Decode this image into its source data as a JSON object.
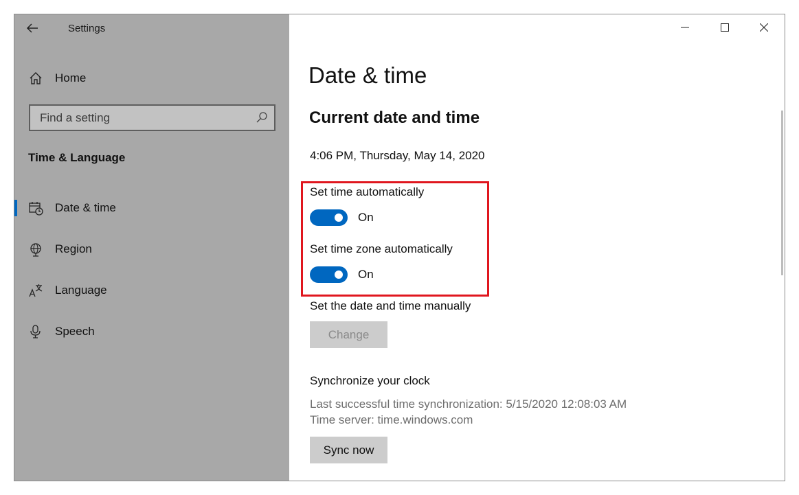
{
  "sidebar": {
    "app_title": "Settings",
    "home_label": "Home",
    "search": {
      "placeholder": "Find a setting"
    },
    "group_title": "Time & Language",
    "items": [
      {
        "label": "Date & time",
        "icon": "calendar-clock-icon",
        "selected": true
      },
      {
        "label": "Region",
        "icon": "globe-icon",
        "selected": false
      },
      {
        "label": "Language",
        "icon": "language-icon",
        "selected": false
      },
      {
        "label": "Speech",
        "icon": "microphone-icon",
        "selected": false
      }
    ]
  },
  "window_controls": [
    "minimize-icon",
    "maximize-icon",
    "close-icon"
  ],
  "main": {
    "page_title": "Date & time",
    "section_title": "Current date and time",
    "current_datetime": "4:06 PM, Thursday, May 14, 2020",
    "set_time_auto": {
      "label": "Set time automatically",
      "state": "On",
      "on": true
    },
    "set_timezone_auto": {
      "label": "Set time zone automatically",
      "state": "On",
      "on": true
    },
    "manual": {
      "label": "Set the date and time manually",
      "button": "Change",
      "enabled": false
    },
    "sync": {
      "header": "Synchronize your clock",
      "last_sync": "Last successful time synchronization: 5/15/2020 12:08:03 AM",
      "server": "Time server: time.windows.com",
      "button": "Sync now"
    }
  },
  "colors": {
    "sidebar_bg": "#a8a8a8",
    "accent": "#0067c0",
    "highlight_box": "#e0161e",
    "button_bg": "#cccccc"
  }
}
